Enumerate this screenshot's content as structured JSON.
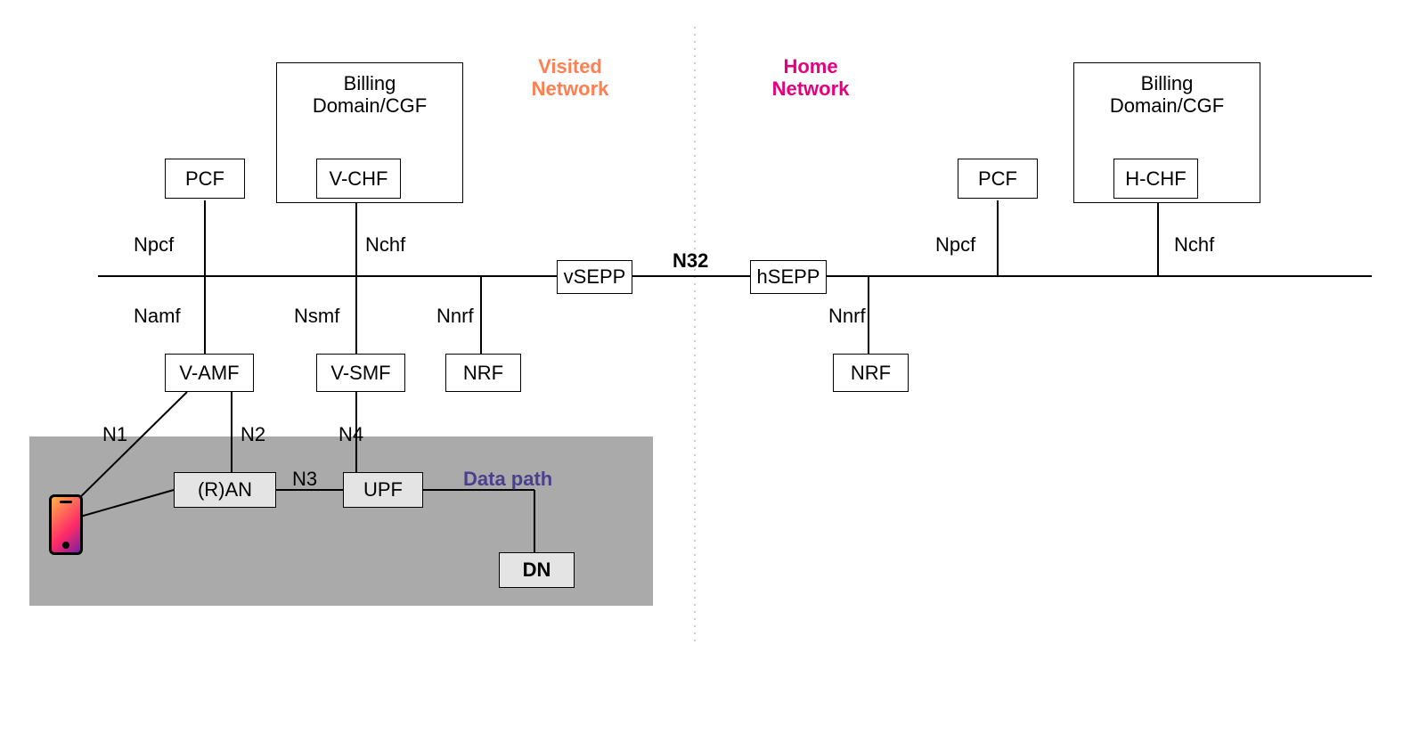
{
  "titles": {
    "visited": "Visited\nNetwork",
    "home": "Home\nNetwork"
  },
  "nodes": {
    "billing_v": "Billing\nDomain/CGF",
    "vchf": "V-CHF",
    "pcf_v": "PCF",
    "vamf": "V-AMF",
    "vsmf": "V-SMF",
    "nrf_v": "NRF",
    "vsepp": "vSEPP",
    "hsepp": "hSEPP",
    "nrf_h": "NRF",
    "pcf_h": "PCF",
    "billing_h": "Billing\nDomain/CGF",
    "hchf": "H-CHF",
    "ran": "(R)AN",
    "upf": "UPF",
    "dn": "DN"
  },
  "interfaces": {
    "npcf_v": "Npcf",
    "nchf_v": "Nchf",
    "namf": "Namf",
    "nsmf": "Nsmf",
    "nnrf_v": "Nnrf",
    "n32": "N32",
    "nnrf_h": "Nnrf",
    "npcf_h": "Npcf",
    "nchf_h": "Nchf",
    "n1": "N1",
    "n2": "N2",
    "n3": "N3",
    "n4": "N4"
  },
  "datapath_label": "Data path",
  "colors": {
    "visited_title": "#ff7f50",
    "home_title": "#e6007e",
    "datapath": "#4b3f8f",
    "data_panel": "#aaaaaa",
    "greybox": "#e4e4e4"
  }
}
